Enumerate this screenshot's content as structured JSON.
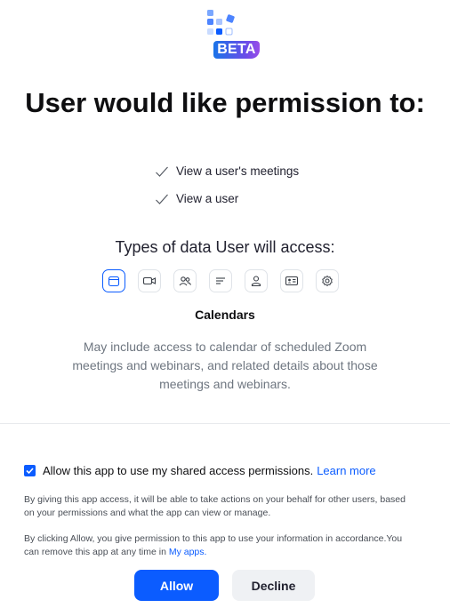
{
  "header": {
    "badge": "BETA",
    "title": "User would like permission to:"
  },
  "permissions": [
    "View a user's meetings",
    "View a user"
  ],
  "data_types": {
    "title": "Types of data User will access:",
    "icons": [
      "calendar-icon",
      "video-camera-icon",
      "contacts-icon",
      "text-lines-icon",
      "user-icon",
      "id-card-icon",
      "settings-gear-icon"
    ],
    "selected": {
      "name": "Calendars",
      "description": "May include access to calendar of scheduled Zoom meetings and webinars, and related details about those meetings and webinars."
    }
  },
  "consent": {
    "checkbox_checked": true,
    "checkbox_label": "Allow this app to use my shared access permissions.",
    "learn_more": "Learn more",
    "note1": "By giving this app access, it will be able to take actions on your behalf for other users, based on your permissions and what the app can view or manage.",
    "note2_prefix": "By clicking Allow, you give permission to this app to use your information in accordance.You can remove this app at any time in ",
    "note2_link": "My apps."
  },
  "actions": {
    "allow": "Allow",
    "decline": "Decline"
  },
  "colors": {
    "primary": "#0b5cff",
    "text": "#0e0e10",
    "muted": "#6e7680",
    "secondary_button": "#eff1f4"
  }
}
